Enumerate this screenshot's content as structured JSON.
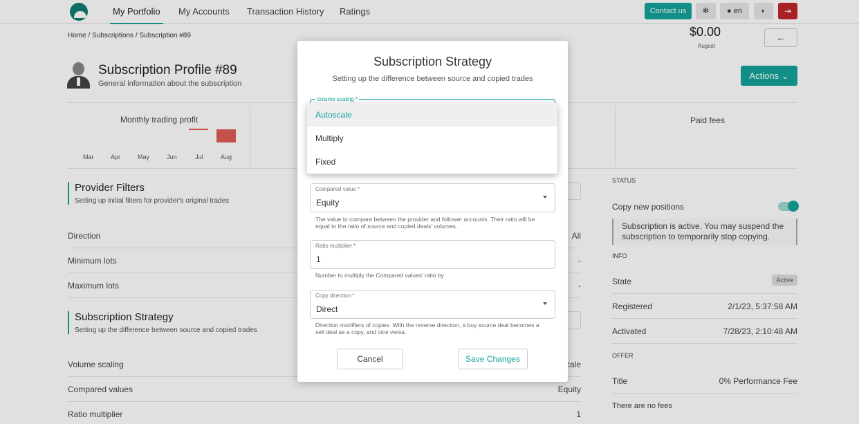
{
  "nav": {
    "items": [
      "My Portfolio",
      "My Accounts",
      "Transaction History",
      "Ratings"
    ],
    "contact_label": "Contact us",
    "settings_icon": "gear-icon",
    "lang_label": "en",
    "theme_icon": "contrast-icon",
    "logout_icon": "logout-icon"
  },
  "breadcrumb": {
    "home": "Home",
    "sep": "/",
    "subscriptions": "Subscriptions",
    "current": "Subscription #89"
  },
  "header": {
    "title": "Subscription Profile #89",
    "subtitle": "General information about the subscription",
    "actions_label": "Actions",
    "back_icon": "←"
  },
  "stats": {
    "profit_title": "Monthly trading profit",
    "months": [
      "Mar",
      "Apr",
      "May",
      "Jun",
      "Jul",
      "Aug"
    ],
    "fees_title": "Paid fees",
    "fees_value": "$0.00",
    "fees_sub": "August"
  },
  "provider_filters": {
    "title": "Provider Filters",
    "subtitle": "Setting up initial filters for provider's original trades",
    "rows": [
      {
        "label": "Direction",
        "value": "All"
      },
      {
        "label": "Minimum lots",
        "value": "-"
      },
      {
        "label": "Maximum lots",
        "value": "-"
      }
    ]
  },
  "strategy": {
    "title": "Subscription Strategy",
    "subtitle": "Setting up the difference between source and copied trades",
    "rows": [
      {
        "label": "Volume scaling",
        "value": "cale"
      },
      {
        "label": "Compared values",
        "value": "Equity"
      },
      {
        "label": "Ratio multiplier",
        "value": "1"
      }
    ]
  },
  "sidebar": {
    "status_heading": "STATUS",
    "copy_label": "Copy new positions",
    "status_note": "Subscription is active. You may suspend the subscription to temporarily stop copying.",
    "info_heading": "INFO",
    "state_label": "State",
    "state_value": "Active",
    "registered_label": "Registered",
    "registered_value": "2/1/23, 5:37:58 AM",
    "activated_label": "Activated",
    "activated_value": "7/28/23, 2:10:48 AM",
    "offer_heading": "OFFER",
    "title_label": "Title",
    "title_value": "0% Performance Fee",
    "no_fees": "There are no fees"
  },
  "dialog": {
    "title": "Subscription Strategy",
    "subtitle": "Setting up the difference between source and copied trades",
    "volume_label": "Volume scaling *",
    "menu_options": [
      "Autoscale",
      "Multiply",
      "Fixed"
    ],
    "compared_label": "Compared value *",
    "compared_value": "Equity",
    "compared_help": "The value to compare between the provider and follower accounts. Their ratio will be equal to the ratio of source and copied deals' volumes.",
    "ratio_label": "Ratio multiplier *",
    "ratio_value": "1",
    "ratio_help": "Number to multiply the Compared values' ratio by",
    "direction_label": "Copy direction *",
    "direction_value": "Direct",
    "direction_help": "Direction modifiers of copies. With the reverse direction, a buy source deal becomes a sell deal as a copy, and vice versa.",
    "cancel_label": "Cancel",
    "save_label": "Save Changes"
  }
}
